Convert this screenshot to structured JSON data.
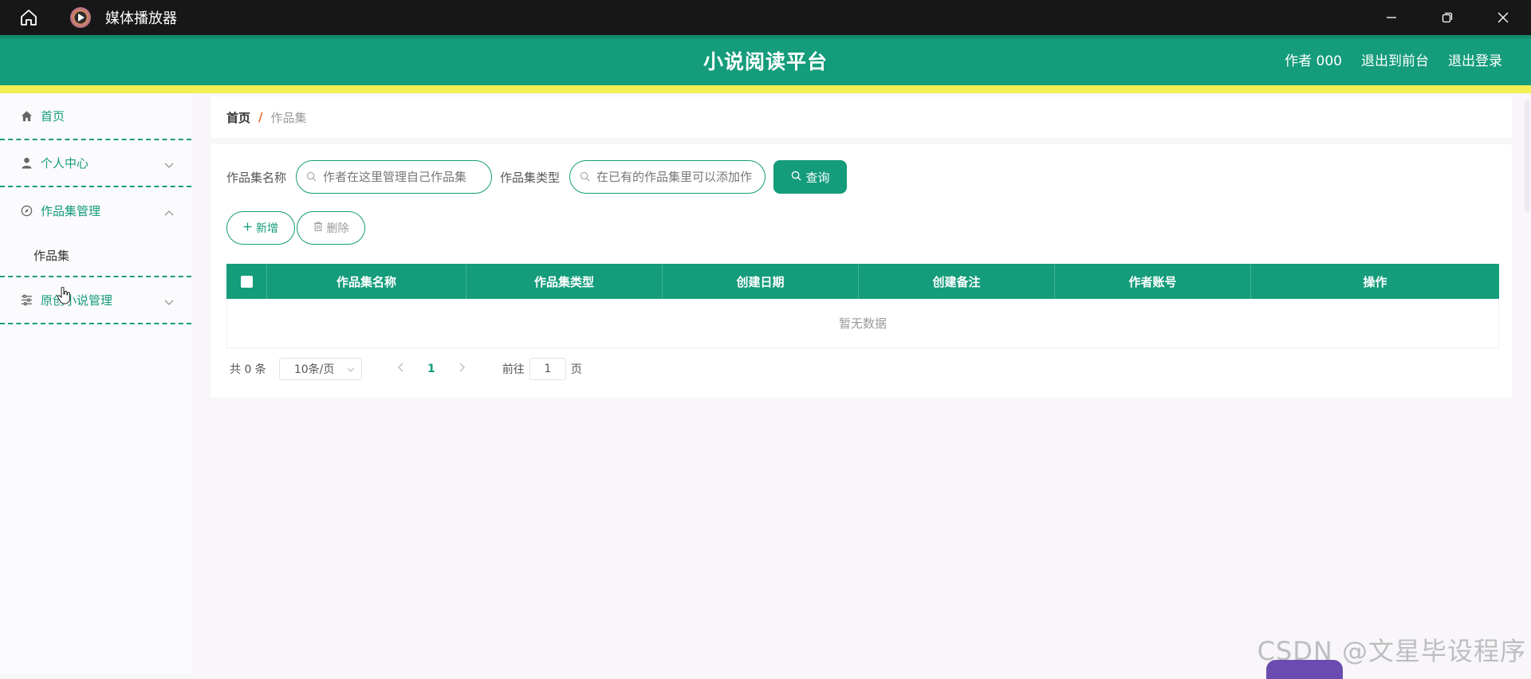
{
  "window": {
    "title": "媒体播放器",
    "controls": [
      "minimize",
      "restore",
      "close"
    ]
  },
  "header": {
    "site_title": "小说阅读平台",
    "links": {
      "user": "作者 000",
      "to_front": "退出到前台",
      "logout": "退出登录"
    }
  },
  "sidebar": {
    "items": [
      {
        "label": "首页",
        "icon": "home-icon"
      },
      {
        "label": "个人中心",
        "icon": "user-icon"
      },
      {
        "label": "作品集管理",
        "icon": "compass-icon"
      },
      {
        "label": "作品集",
        "icon": ""
      },
      {
        "label": "原创小说管理",
        "icon": "sliders-icon"
      }
    ]
  },
  "breadcrumb": {
    "home": "首页",
    "separator": "/",
    "current": "作品集"
  },
  "search": {
    "name_label": "作品集名称",
    "name_placeholder": "作者在这里管理自己作品集",
    "type_label": "作品集类型",
    "type_placeholder": "在已有的作品集里可以添加作",
    "query_button": "查询"
  },
  "actions": {
    "add": "新增",
    "delete": "删除"
  },
  "table": {
    "columns": [
      "作品集名称",
      "作品集类型",
      "创建日期",
      "创建备注",
      "作者账号",
      "操作"
    ],
    "rows": [],
    "empty_text": "暂无数据"
  },
  "pagination": {
    "total": "共 0 条",
    "page_size": "10条/页",
    "current_page": "1",
    "goto_label": "前往",
    "goto_value": "1",
    "page_suffix": "页"
  },
  "watermark": "CSDN @文星毕设程序",
  "colors": {
    "primary": "#149c7b",
    "accent_strip": "#f4ee55",
    "titlebar": "#171717"
  }
}
